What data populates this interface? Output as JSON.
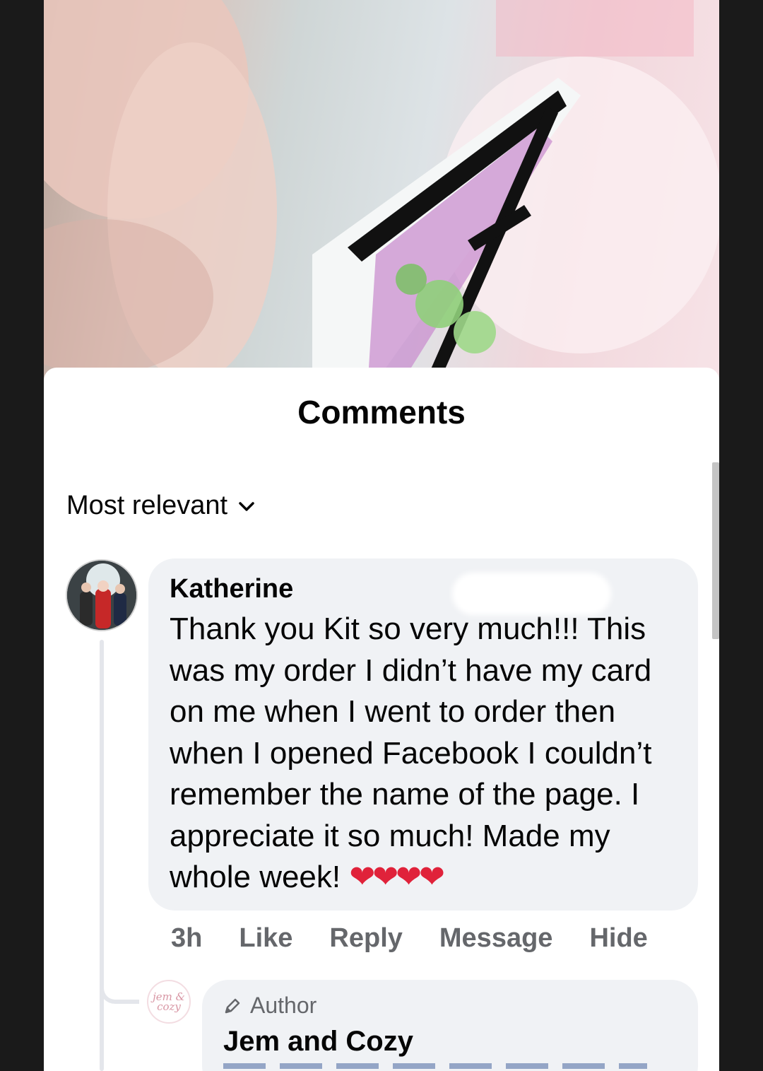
{
  "sheet": {
    "title": "Comments"
  },
  "sort": {
    "label": "Most relevant"
  },
  "comment": {
    "author": "Katherine",
    "text": "Thank you Kit so very much!!! This was my order I didn’t have my card on me when I went to order then when I opened Facebook I couldn’t remember the name of the page. I appreciate it so much! Made my whole week!",
    "emoji": "❤❤❤❤",
    "time": "3h",
    "actions": {
      "like": "Like",
      "reply": "Reply",
      "message": "Message",
      "hide": "Hide"
    }
  },
  "reply": {
    "badge": "Author",
    "author": "Jem and Cozy",
    "avatar_text": "jem & cozy"
  },
  "colors": {
    "bubble": "#f0f2f5",
    "meta_text": "#65676b",
    "heart": "#e0223a"
  }
}
